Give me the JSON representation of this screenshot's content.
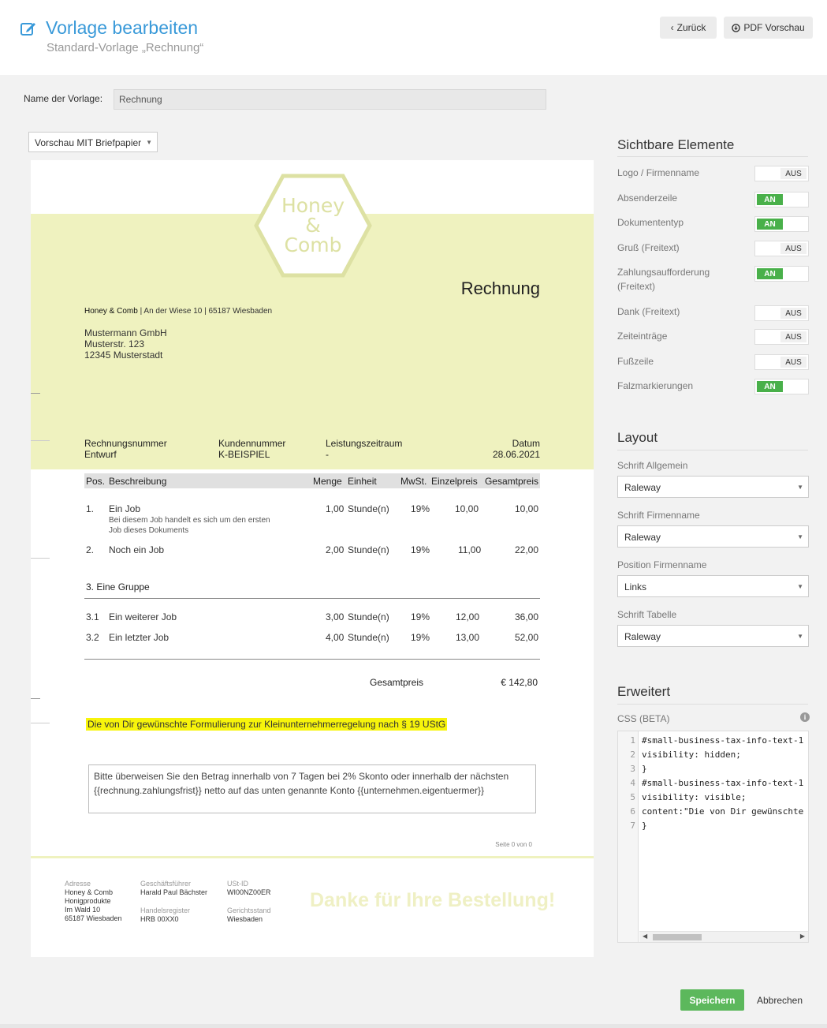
{
  "header": {
    "title": "Vorlage bearbeiten",
    "subtitle": "Standard-Vorlage „Rechnung“",
    "back_label": "Zurück",
    "pdf_label": "PDF Vorschau"
  },
  "template_name": {
    "label": "Name der Vorlage:",
    "value": "Rechnung"
  },
  "preview_select": {
    "value": "Vorschau MIT Briefpapier"
  },
  "document": {
    "logo_lines": [
      "Honey",
      "&",
      "Comb"
    ],
    "type": "Rechnung",
    "sender_company": "Honey & Comb",
    "sender_rest": " | An der Wiese 10 | 65187 Wiesbaden",
    "recipient": [
      "Mustermann GmbH",
      "Musterstr. 123",
      "12345 Musterstadt"
    ],
    "meta": {
      "invoice_no_label": "Rechnungsnummer",
      "invoice_no": "Entwurf",
      "customer_no_label": "Kundennummer",
      "customer_no": "K-BEISPIEL",
      "period_label": "Leistungszeitraum",
      "period": "-",
      "date_label": "Datum",
      "date": "28.06.2021"
    },
    "table_head": {
      "pos": "Pos.",
      "desc": "Beschreibung",
      "qty": "Menge",
      "unit": "Einheit",
      "vat": "MwSt.",
      "price": "Einzelpreis",
      "total": "Gesamtpreis"
    },
    "rows": [
      {
        "pos": "1.",
        "desc": "Ein Job",
        "desc2a": "Bei diesem Job handelt es sich um den ersten",
        "desc2b": "Job dieses Dokuments",
        "qty": "1,00",
        "unit": "Stunde(n)",
        "vat": "19%",
        "price": "10,00",
        "total": "10,00"
      },
      {
        "pos": "2.",
        "desc": "Noch ein Job",
        "qty": "2,00",
        "unit": "Stunde(n)",
        "vat": "19%",
        "price": "11,00",
        "total": "22,00"
      },
      {
        "pos": "3.1",
        "desc": "Ein weiterer Job",
        "qty": "3,00",
        "unit": "Stunde(n)",
        "vat": "19%",
        "price": "12,00",
        "total": "36,00"
      },
      {
        "pos": "3.2",
        "desc": "Ein letzter Job",
        "qty": "4,00",
        "unit": "Stunde(n)",
        "vat": "19%",
        "price": "13,00",
        "total": "52,00"
      }
    ],
    "group_title": "3. Eine Gruppe",
    "total_label": "Gesamtpreis",
    "total_value": "€ 142,80",
    "small_business_text": "Die von Dir gewünschte Formulierung zur Kleinunternehmerregelung nach § 19 UStG",
    "payment_text": "Bitte überweisen Sie den Betrag innerhalb von 7 Tagen bei 2% Skonto oder innerhalb der nächsten {{rechnung.zahlungsfrist}} netto auf das unten genannte Konto {{unternehmen.eigentuermer}}",
    "page_no": "Seite 0 von 0",
    "footer": {
      "address_label": "Adresse",
      "address": [
        "Honey & Comb",
        "Honigprodukte",
        "Im Wald 10",
        "65187 Wiesbaden"
      ],
      "ceo_label": "Geschäftsführer",
      "ceo": "Harald Paul Bächster",
      "register_label": "Handelsregister",
      "register": "HRB 00XX0",
      "vat_id_label": "USt-ID",
      "vat_id": "WI00NZ00ER",
      "court_label": "Gerichtsstand",
      "court": "Wiesbaden",
      "thanks": "Danke für Ihre Bestellung!"
    }
  },
  "visible_elements": {
    "title": "Sichtbare Elemente",
    "on_label": "AN",
    "off_label": "AUS",
    "items": [
      {
        "label": "Logo / Firmenname",
        "on": false
      },
      {
        "label": "Absenderzeile",
        "on": true
      },
      {
        "label": "Dokumententyp",
        "on": true
      },
      {
        "label": "Gruß (Freitext)",
        "on": false
      },
      {
        "label": "Zahlungsaufforderung (Freitext)",
        "on": true
      },
      {
        "label": "Dank (Freitext)",
        "on": false
      },
      {
        "label": "Zeiteinträge",
        "on": false
      },
      {
        "label": "Fußzeile",
        "on": false
      },
      {
        "label": "Falzmarkierungen",
        "on": true
      }
    ]
  },
  "layout": {
    "title": "Layout",
    "fields": [
      {
        "label": "Schrift Allgemein",
        "value": "Raleway"
      },
      {
        "label": "Schrift Firmenname",
        "value": "Raleway"
      },
      {
        "label": "Position Firmenname",
        "value": "Links"
      },
      {
        "label": "Schrift Tabelle",
        "value": "Raleway"
      }
    ]
  },
  "advanced": {
    "title": "Erweitert",
    "css_label": "CSS (BETA)",
    "lines": [
      {
        "n": "1",
        "text": "#small-business-tax-info-text-1"
      },
      {
        "n": "2",
        "text": "visibility: hidden;"
      },
      {
        "n": "3",
        "text": "}"
      },
      {
        "n": "4",
        "text": "#small-business-tax-info-text-1"
      },
      {
        "n": "5",
        "text": "visibility: visible;"
      },
      {
        "n": "6",
        "text": "content:\"Die von Dir gewünschte"
      },
      {
        "n": "7",
        "text": "}"
      }
    ]
  },
  "actions": {
    "save": "Speichern",
    "cancel": "Abbrechen"
  },
  "colors": {
    "accent": "#3a9ad9",
    "band": "#eff2bf",
    "toggle_on": "#49b04a",
    "save": "#5cb85c",
    "highlight": "#f7f40b"
  }
}
